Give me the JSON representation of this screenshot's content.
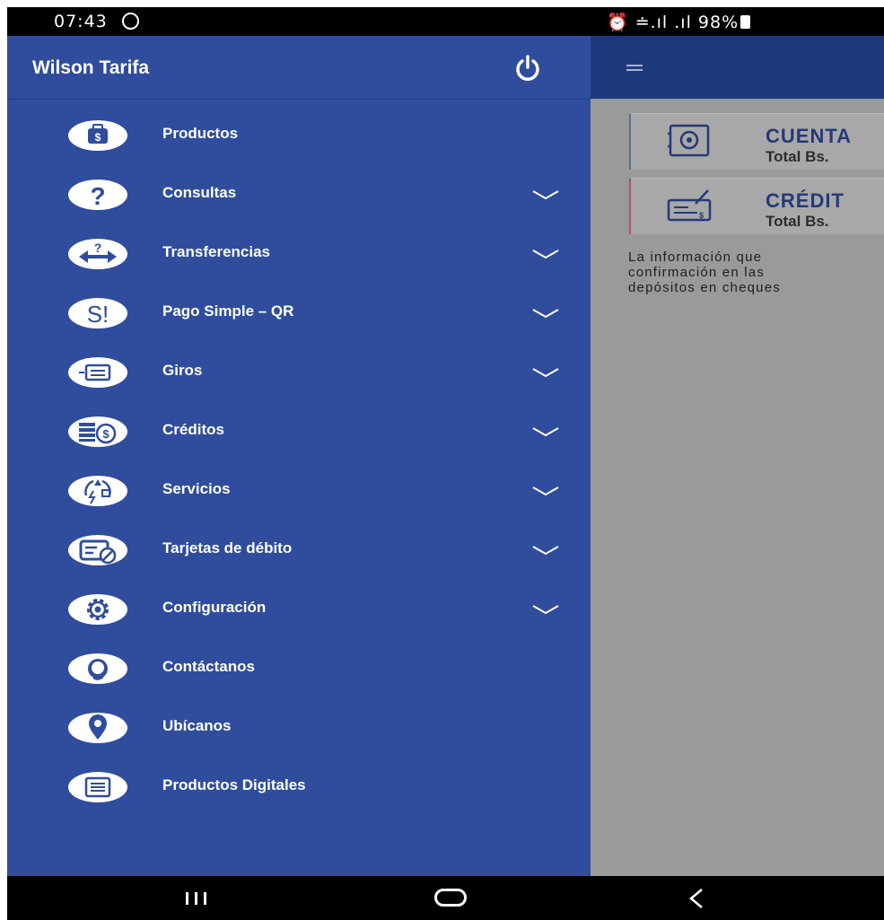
{
  "status_bar": {
    "time": "07:43",
    "right": "⏰ ≐.ıl .ıl 98%"
  },
  "drawer": {
    "user_name": "Wilson Tarifa",
    "items": [
      {
        "label": "Productos",
        "icon": "briefcase-dollar-icon",
        "expandable": false
      },
      {
        "label": "Consultas",
        "icon": "question-icon",
        "expandable": true
      },
      {
        "label": "Transferencias",
        "icon": "transfer-icon",
        "expandable": true
      },
      {
        "label": "Pago Simple – QR",
        "icon": "pago-simple-icon",
        "expandable": true
      },
      {
        "label": "Giros",
        "icon": "remittance-icon",
        "expandable": true
      },
      {
        "label": "Créditos",
        "icon": "coins-icon",
        "expandable": true
      },
      {
        "label": "Servicios",
        "icon": "services-icon",
        "expandable": true
      },
      {
        "label": "Tarjetas de débito",
        "icon": "debit-card-icon",
        "expandable": true
      },
      {
        "label": "Configuración",
        "icon": "gear-icon",
        "expandable": true
      },
      {
        "label": "Contáctanos",
        "icon": "headset-icon",
        "expandable": false
      },
      {
        "label": "Ubícanos",
        "icon": "location-pin-icon",
        "expandable": false
      },
      {
        "label": "Productos Digitales",
        "icon": "digital-products-icon",
        "expandable": false
      }
    ]
  },
  "background": {
    "cards": [
      {
        "title": "CUENTA",
        "subtitle": "Total Bs."
      },
      {
        "title": "CRÉDIT",
        "subtitle": "Total Bs."
      }
    ],
    "info_lines": [
      "La información que",
      "confirmación en las",
      "depósitos en cheques"
    ]
  },
  "colors": {
    "drawer": "#2f4d9c",
    "header": "#1f3a7a",
    "scrim": "#9a9a9a"
  }
}
